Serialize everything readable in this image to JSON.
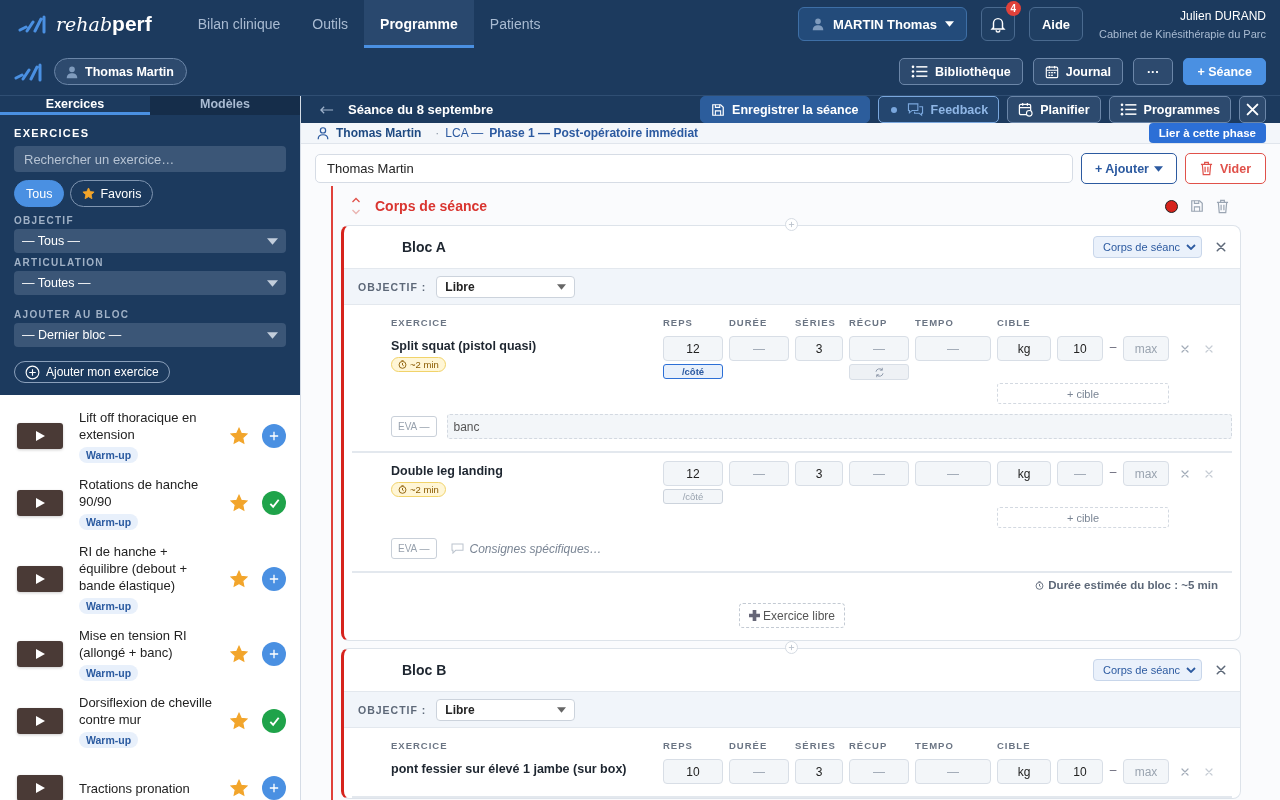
{
  "header": {
    "logo": {
      "part1": "rehab",
      "part2": "perf"
    },
    "nav": [
      {
        "label": "Bilan clinique",
        "selected": false
      },
      {
        "label": "Outils",
        "selected": false
      },
      {
        "label": "Programme",
        "selected": true
      },
      {
        "label": "Patients",
        "selected": false
      }
    ],
    "patient_select": "MARTIN Thomas",
    "notifications": "4",
    "help": "Aide",
    "user": {
      "name": "Julien DURAND",
      "org": "Cabinet de Kinésithérapie du Parc"
    }
  },
  "subbar": {
    "patient_chip": "Thomas Martin",
    "buttons": [
      {
        "label": "Bibliothèque",
        "kind": "list"
      },
      {
        "label": "Journal",
        "kind": "calendar"
      },
      {
        "label": "···",
        "kind": "more"
      },
      {
        "label": "+ Séance",
        "kind": "primary"
      }
    ]
  },
  "sidebar": {
    "tabs": [
      {
        "label": "Exercices",
        "selected": true
      },
      {
        "label": "Modèles",
        "selected": false
      }
    ],
    "heading": "EXERCICES",
    "search": {
      "placeholder": "Rechercher un exercice…"
    },
    "filters": [
      {
        "label": "Tous",
        "selected": true,
        "kind": "plain"
      },
      {
        "label": "Favoris",
        "selected": false,
        "kind": "star"
      }
    ],
    "selects": [
      {
        "label": "OBJECTIF",
        "value": "— Tous —"
      },
      {
        "label": "ARTICULATION",
        "value": "— Toutes —"
      },
      {
        "label": "AJOUTER AU BLOC",
        "value": "— Dernier bloc —"
      }
    ],
    "add_button": "Ajouter mon exercice",
    "exercises": [
      {
        "title": "Lift off thoracique en extension",
        "tag": "Warm-up",
        "favorite": true,
        "added": false
      },
      {
        "title": "Rotations de hanche 90/90",
        "tag": "Warm-up",
        "favorite": true,
        "added": true
      },
      {
        "title": "RI de hanche + équilibre (debout + bande élastique)",
        "tag": "Warm-up",
        "favorite": true,
        "added": false
      },
      {
        "title": "Mise en tension RI (allongé + banc)",
        "tag": "Warm-up",
        "favorite": true,
        "added": false
      },
      {
        "title": "Dorsiflexion de cheville contre mur",
        "tag": "Warm-up",
        "favorite": true,
        "added": true
      },
      {
        "title": "Tractions pronation",
        "favorite": true,
        "added": false
      }
    ]
  },
  "session": {
    "title": "Séance du 8 septembre",
    "actions": [
      {
        "label": "Enregistrer la séance",
        "kind": "save"
      },
      {
        "label": "Feedback",
        "kind": "feedback"
      },
      {
        "label": "Planifier",
        "kind": "schedule"
      },
      {
        "label": "Programmes",
        "kind": "list"
      }
    ],
    "patient": "Thomas Martin",
    "separator": "·",
    "pathology": "LCA —",
    "phase": "Phase 1 — Post-opératoire immédiat",
    "link_button": "Lier à cette phase",
    "name_field": "Thomas Martin",
    "add_button": "+ Ajouter",
    "clear_button": "Vider",
    "section": {
      "title": "Corps de séance",
      "blocks": [
        {
          "title": "Bloc A",
          "section_select": "Corps de séanc",
          "objective_label": "OBJECTIF :",
          "objective": "Libre",
          "columns": [
            "EXERCICE",
            "REPS",
            "DURÉE",
            "SÉRIES",
            "RÉCUP",
            "TEMPO",
            "CIBLE"
          ],
          "exercises": [
            {
              "name": "Split squat (pistol quasi)",
              "duration": "~2 min",
              "reps": "12",
              "per_side": "/côté",
              "per_side_on": true,
              "duree": "—",
              "series": "3",
              "recup": "—",
              "recup_toggle": true,
              "tempo": "—",
              "unit": "kg",
              "target_min": "10",
              "range_separator": "–",
              "target_max": "max",
              "add_target": "+ cible",
              "eva": "EVA —",
              "note": "banc"
            },
            {
              "name": "Double leg landing",
              "duration": "~2 min",
              "reps": "12",
              "per_side": "/côté",
              "per_side_on": false,
              "duree": "—",
              "series": "3",
              "recup": "—",
              "recup_toggle": false,
              "tempo": "—",
              "unit": "kg",
              "target_min": "—",
              "range_separator": "–",
              "target_max": "max",
              "add_target": "+ cible",
              "eva": "EVA —",
              "note_placeholder": "Consignes spécifiques…"
            }
          ],
          "estimate": "Durée estimée du bloc : ~5 min",
          "free_button": "Exercice libre"
        },
        {
          "title": "Bloc B",
          "section_select": "Corps de séanc",
          "objective_label": "OBJECTIF :",
          "objective": "Libre",
          "columns": [
            "EXERCICE",
            "REPS",
            "DURÉE",
            "SÉRIES",
            "RÉCUP",
            "TEMPO",
            "CIBLE"
          ],
          "exercises": [
            {
              "name": "pont fessier sur élevé 1 jambe (sur box)",
              "reps": "10",
              "duree": "—",
              "series": "3",
              "recup": "—",
              "tempo": "—",
              "unit": "kg",
              "target_min": "10",
              "range_separator": "–",
              "target_max": "max"
            }
          ]
        }
      ]
    }
  }
}
